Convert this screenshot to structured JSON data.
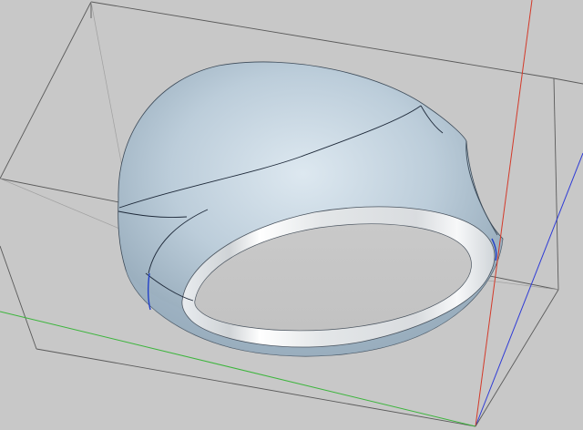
{
  "viewport": {
    "background": "#c8c8c8",
    "axis_colors": {
      "x": "#3cb53c",
      "y": "#2e3bd6",
      "z": "#d33a2a"
    },
    "surface_colors": {
      "light": "#dbe6ee",
      "mid": "#b8c9d6",
      "dark": "#8ea3b3",
      "rim": "#f2f3f4"
    },
    "edge_colors": {
      "boundary": "#1f2a3a",
      "seam": "#2340c8",
      "bbox": "#555555"
    }
  },
  "model": {
    "shape": "ring-like shell with an elliptical cut-out, shown inside its bounding box",
    "visible_text": []
  }
}
